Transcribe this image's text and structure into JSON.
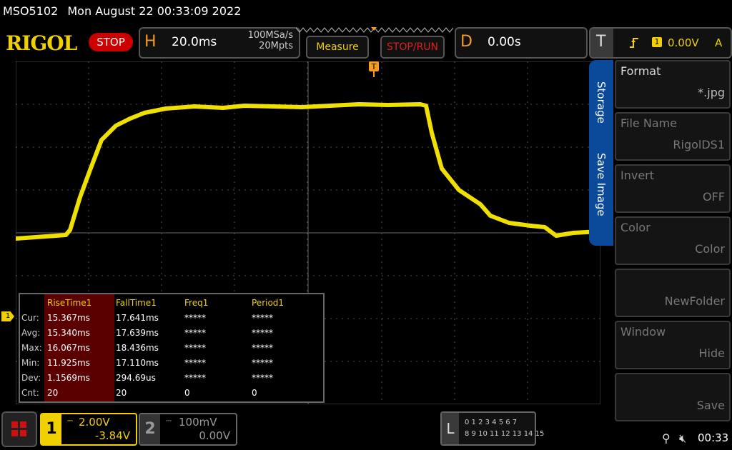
{
  "status": {
    "model": "MSO5102",
    "datetime": "Mon August 22 00:33:09 2022"
  },
  "brand": {
    "logo": "RIGOL",
    "run_state": "STOP"
  },
  "horizontal": {
    "letter": "H",
    "timebase": "20.0ms",
    "sample_rate": "100MSa/s",
    "memory_depth": "20Mpts"
  },
  "toolbar": {
    "measure_label": "Measure",
    "stop_run_label": "STOP/RUN"
  },
  "delay": {
    "letter": "D",
    "value": "0.00s"
  },
  "trigger": {
    "letter": "T",
    "channel": "1",
    "level": "0.00V",
    "mode": "A"
  },
  "channel_marker": "1",
  "measurements": {
    "headers": [
      "RiseTime1",
      "FallTime1",
      "Freq1",
      "Period1"
    ],
    "rows": [
      {
        "label": "Cur:",
        "values": [
          "15.367ms",
          "17.641ms",
          "*****",
          "*****"
        ]
      },
      {
        "label": "Avg:",
        "values": [
          "15.340ms",
          "17.639ms",
          "*****",
          "*****"
        ]
      },
      {
        "label": "Max:",
        "values": [
          "16.067ms",
          "18.436ms",
          "*****",
          "*****"
        ]
      },
      {
        "label": "Min:",
        "values": [
          "11.925ms",
          "17.110ms",
          "*****",
          "*****"
        ]
      },
      {
        "label": "Dev:",
        "values": [
          "1.1569ms",
          "294.69us",
          "*****",
          "*****"
        ]
      },
      {
        "label": "Cnt:",
        "values": [
          "20",
          "20",
          "0",
          "0"
        ]
      }
    ]
  },
  "side_menu": {
    "tabs": [
      "Storage",
      "Save Image"
    ],
    "items": [
      {
        "title": "Format",
        "value": "*.jpg"
      },
      {
        "title": "File Name",
        "value": "RigolDS1"
      },
      {
        "title": "Invert",
        "value": "OFF"
      },
      {
        "title": "Color",
        "value": "Color"
      },
      {
        "title": "",
        "value": "NewFolder"
      },
      {
        "title": "Window",
        "value": "Hide"
      },
      {
        "title": "",
        "value": "Save"
      }
    ]
  },
  "channels": {
    "ch1": {
      "number": "1",
      "scale": "2.00V",
      "offset": "-3.84V"
    },
    "ch2": {
      "number": "2",
      "scale": "100mV",
      "offset": "0.00V"
    }
  },
  "logic": {
    "letter": "L",
    "row1": "0 1 2 3   4 5 6 7",
    "row2": "8 9 10 11  12 13 14 15"
  },
  "clock": "00:33",
  "colors": {
    "ch1": "#f0e000",
    "accent": "#0b4a9a",
    "stop": "#cc0000",
    "horizontal": "#f59a23"
  }
}
